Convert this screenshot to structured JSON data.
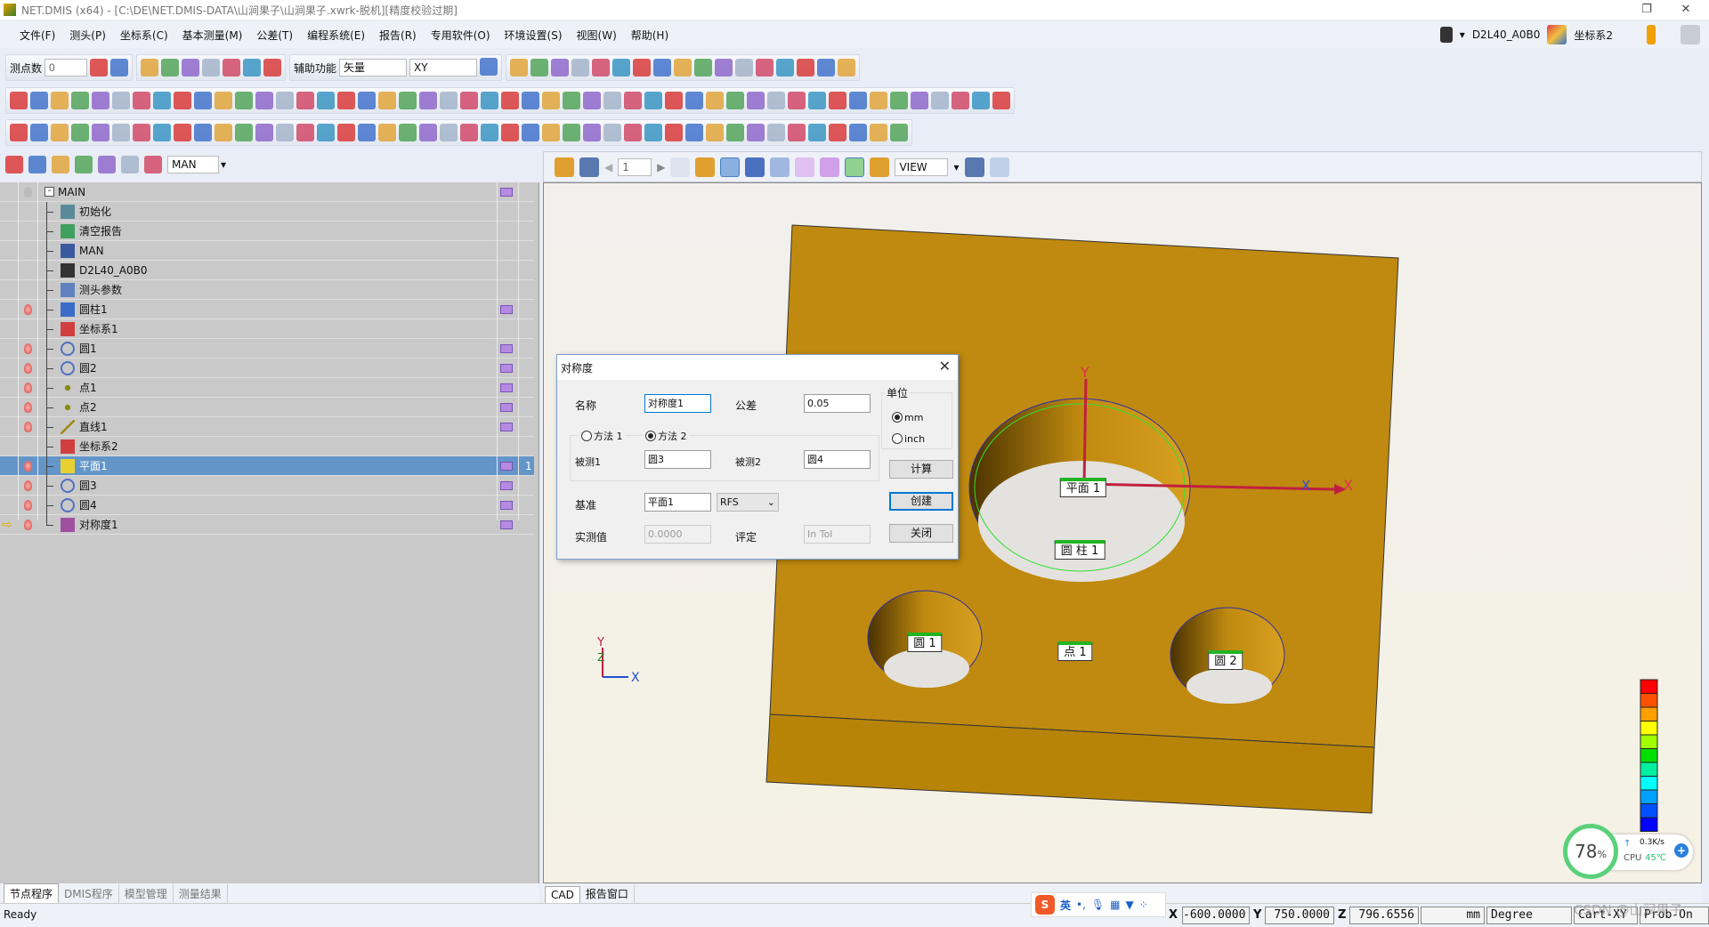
{
  "window": {
    "title": "NET.DMIS (x64) - [C:\\DE\\NET.DMIS-DATA\\山涧果子\\山涧果子.xwrk-脱机][精度校验过期]"
  },
  "menu": [
    "文件(F)",
    "测头(P)",
    "坐标系(C)",
    "基本测量(M)",
    "公差(T)",
    "编程系统(E)",
    "报告(R)",
    "专用软件(O)",
    "环境设置(S)",
    "视图(W)",
    "帮助(H)"
  ],
  "topright": {
    "probe": "D2L40_A0B0",
    "coord_system": "坐标系2"
  },
  "toolbar1": {
    "points_label": "测点数",
    "points_value": "0",
    "aux_label": "辅助功能",
    "aux_mode": "矢量",
    "plane": "XY"
  },
  "toolbar4": {
    "mode": "MAN"
  },
  "toolbar_icons": {
    "row1": [
      "erase-point-icon",
      "erase-all-points-icon",
      "run-icon",
      "joystick-icon",
      "arrow-right-icon",
      "xyz-box-icon",
      "report-icon",
      "home-icon",
      "warning-icon",
      "lock-icon",
      "measure-probe-icon",
      "move-icon",
      "zoom-in-icon",
      "zoom-out-icon",
      "rotate-icon",
      "zoom-fit-icon",
      "view-cube-icon",
      "sphere-view-icon",
      "select-icon",
      "pointer-icon",
      "probe-path-icon",
      "pin-icon",
      "layer-icon",
      "screen-icon",
      "camera-icon",
      "sync-icon",
      "probe-toggle-icon"
    ],
    "row2": [
      "point-icon",
      "line-icon",
      "circle-icon",
      "arc-icon",
      "ellipse-icon",
      "plane-icon",
      "rectangle-icon",
      "slot-icon",
      "cylinder-icon",
      "sphere-icon",
      "cone-icon",
      "torus-icon",
      "curve-icon",
      "surface-icon",
      "angle-icon",
      "help-icon",
      "path-icon",
      "point-icon",
      "line-icon",
      "circle-icon",
      "arc-icon",
      "ellipse-icon",
      "plane-icon",
      "rectangle-icon",
      "slot-icon",
      "cylinder-icon",
      "sphere-icon",
      "cone-icon",
      "torus-icon",
      "box-icon",
      "transform-icon",
      "arrows-icon",
      "corner-icon",
      "polygon-icon",
      "check-icon",
      "point-icon",
      "line-icon",
      "circle-icon",
      "ellipse-icon",
      "plane-icon",
      "rectangle-icon",
      "slot-icon",
      "cylinder-icon",
      "sphere-icon",
      "cone-icon",
      "curve-icon",
      "surface-icon",
      "grid-icon",
      "dots-icon"
    ],
    "row3": [
      "init-coord-icon",
      "coord-folder-icon",
      "coord-box-icon",
      "coord-fit-icon",
      "rps-icon",
      "coord-plane-icon",
      "coord-cyl-icon",
      "coord-table-icon",
      "align-icon",
      "refresh-icon",
      "coord-active-icon",
      "coord-switch-icon",
      "report-edit-icon",
      "cyl-a-icon",
      "cyl-b-icon",
      "cyl-c-icon",
      "cyl-d-icon",
      "cyl-e-icon",
      "cyl-f-icon",
      "cyl-g-icon",
      "cyl-h-icon",
      "report-icon",
      "flatness-icon",
      "profile-icon",
      "arc-tol-icon",
      "tol-help-icon",
      "angle-tol-icon",
      "straightness-icon",
      "flat-icon",
      "circularity-icon",
      "cylindricity-icon",
      "parallel-icon",
      "perpendicular-icon",
      "angularity-icon",
      "position-icon",
      "concentric-icon",
      "symmetry-icon",
      "runout-icon",
      "total-runout-icon",
      "target-icon",
      "cross-icon",
      "distance-icon",
      "width-icon",
      "chart-icon"
    ],
    "row4": [
      "auto-icon",
      "stop-icon",
      "list-icon",
      "unlock-icon",
      "window-icon",
      "probe-balls-icon",
      "probe-down-icon"
    ]
  },
  "tree": {
    "rows": [
      {
        "label": "MAIN",
        "icon": "minus-box-icon",
        "bulb": "off",
        "report": true,
        "root": true
      },
      {
        "label": "初始化",
        "icon": "init-icon"
      },
      {
        "label": "清空报告",
        "icon": "clear-report-icon"
      },
      {
        "label": "MAN",
        "icon": "mode-icon"
      },
      {
        "label": "D2L40_A0B0",
        "icon": "probe-icon"
      },
      {
        "label": "测头参数",
        "icon": "probe-params-icon"
      },
      {
        "label": "圆柱1",
        "icon": "cylinder-icon",
        "bulb": "on",
        "report": true
      },
      {
        "label": "坐标系1",
        "icon": "coord-system-icon"
      },
      {
        "label": "圆1",
        "icon": "circle-icon",
        "bulb": "on",
        "report": true
      },
      {
        "label": "圆2",
        "icon": "circle-icon",
        "bulb": "on",
        "report": true
      },
      {
        "label": "点1",
        "icon": "point-icon",
        "bulb": "on",
        "report": true
      },
      {
        "label": "点2",
        "icon": "point-icon",
        "bulb": "on",
        "report": true
      },
      {
        "label": "直线1",
        "icon": "line-icon",
        "bulb": "on",
        "report": true
      },
      {
        "label": "坐标系2",
        "icon": "coord-system-icon"
      },
      {
        "label": "平面1",
        "icon": "plane-icon",
        "bulb": "on",
        "report": true,
        "selected": true,
        "count": "1"
      },
      {
        "label": "圆3",
        "icon": "circle-icon",
        "bulb": "on",
        "report": true
      },
      {
        "label": "圆4",
        "icon": "circle-icon",
        "bulb": "on",
        "report": true
      },
      {
        "label": "对称度1",
        "icon": "symmetry-icon",
        "bulb": "on",
        "report": true,
        "current": true
      }
    ]
  },
  "left_tabs": [
    "节点程序",
    "DMIS程序",
    "模型管理",
    "测量结果"
  ],
  "viewport_toolbar": {
    "page": "1",
    "view": "VIEW"
  },
  "viewport_tabs": [
    "CAD",
    "报告窗口"
  ],
  "viewport": {
    "feature_labels": [
      {
        "name": "平面1",
        "text": "平面 1"
      },
      {
        "name": "圆柱1",
        "text": "圆 柱 1"
      },
      {
        "name": "圆1",
        "text": "圆 1"
      },
      {
        "name": "点1",
        "text": "点 1"
      },
      {
        "name": "圆2",
        "text": "圆 2"
      }
    ],
    "axis_labels": {
      "x": "X",
      "y": "Y",
      "z": "Z"
    },
    "part_color": "#c08a10",
    "color_scale": [
      "#ff0000",
      "#ff5000",
      "#ffa000",
      "#ffff00",
      "#a0ff00",
      "#00e000",
      "#00f0a0",
      "#00ffff",
      "#00a0ff",
      "#0050ff",
      "#0000ff"
    ]
  },
  "dialog": {
    "title": "对称度",
    "name_label": "名称",
    "name_value": "对称度1",
    "tol_label": "公差",
    "tol_value": "0.05",
    "units_label": "单位",
    "unit_mm": "mm",
    "unit_inch": "inch",
    "unit_selected": "mm",
    "method1": "方法 1",
    "method2": "方法 2",
    "method_selected": "方法 2",
    "meas1_label": "被测1",
    "meas1_value": "圆3",
    "meas2_label": "被测2",
    "meas2_value": "圆4",
    "datum_label": "基准",
    "datum_value": "平面1",
    "modifier": "RFS",
    "actual_label": "实测值",
    "actual_value": "0.0000",
    "eval_label": "评定",
    "eval_value": "In Tol",
    "calc": "计算",
    "create": "创建",
    "close": "关闭"
  },
  "cpu_widget": {
    "percent": "78",
    "percent_sign": "%",
    "net": "0.3K/s",
    "cpu_label": "CPU",
    "temp": "45℃"
  },
  "ime": {
    "lang": "英"
  },
  "status": {
    "ready": "Ready",
    "x_label": "X",
    "x": "-600.0000",
    "y_label": "Y",
    "y": "750.0000",
    "z_label": "Z",
    "z": "796.6556",
    "unit": "mm",
    "angle": "Degree",
    "coord": "Cart-XY",
    "probe": "Prob-On"
  },
  "watermark": "CSDN @山涧果子"
}
